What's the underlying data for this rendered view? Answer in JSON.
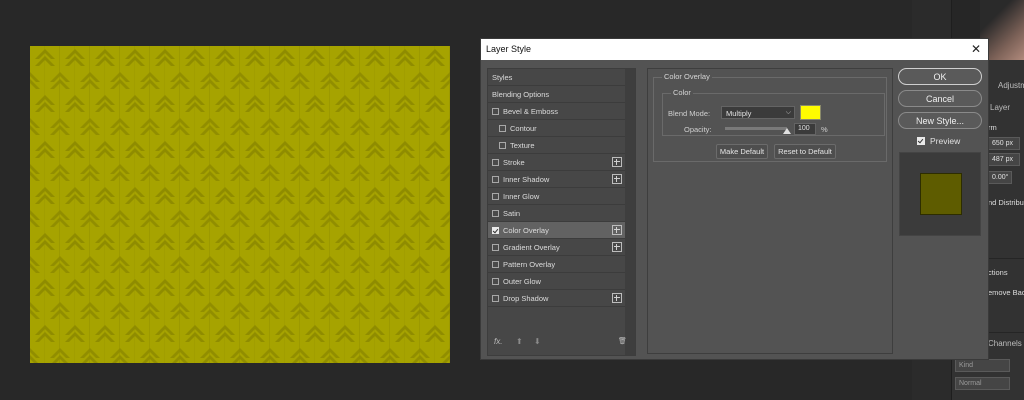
{
  "dialog": {
    "title": "Layer Style",
    "close": "✕"
  },
  "styles_list": [
    {
      "label": "Styles",
      "type": "header"
    },
    {
      "label": "Blending Options",
      "type": "header"
    },
    {
      "label": "Bevel & Emboss",
      "checked": false,
      "plus": false
    },
    {
      "label": "Contour",
      "checked": false,
      "sub": true
    },
    {
      "label": "Texture",
      "checked": false,
      "sub": true
    },
    {
      "label": "Stroke",
      "checked": false,
      "plus": true
    },
    {
      "label": "Inner Shadow",
      "checked": false,
      "plus": true
    },
    {
      "label": "Inner Glow",
      "checked": false
    },
    {
      "label": "Satin",
      "checked": false
    },
    {
      "label": "Color Overlay",
      "checked": true,
      "plus": true,
      "active": true
    },
    {
      "label": "Gradient Overlay",
      "checked": false,
      "plus": true
    },
    {
      "label": "Pattern Overlay",
      "checked": false
    },
    {
      "label": "Outer Glow",
      "checked": false
    },
    {
      "label": "Drop Shadow",
      "checked": false,
      "plus": true
    }
  ],
  "styles_footer": {
    "fx": "fx.",
    "up": "⬆",
    "down": "⬇",
    "trash": "🗑"
  },
  "color_overlay": {
    "group_title": "Color Overlay",
    "inner_title": "Color",
    "blend_mode_label": "Blend Mode:",
    "blend_mode_value": "Multiply",
    "color": "#fffc00",
    "opacity_label": "Opacity:",
    "opacity_value": "100",
    "opacity_unit": "%",
    "opacity_fraction": 1.0,
    "make_default": "Make Default",
    "reset_default": "Reset to Default"
  },
  "buttons": {
    "ok": "OK",
    "cancel": "Cancel",
    "new_style": "New Style...",
    "preview_label": "Preview",
    "preview_checked": true
  },
  "right_panel": {
    "tab_adjust": "Adjustm",
    "tab_layer": "Layer",
    "section_transform": "rm",
    "width": "650 px",
    "height": "487 px",
    "angle": "0.00°",
    "align_label": "nd Distribu",
    "quick_actions": "ctions",
    "remove_bg": "emove Back",
    "channels_tab": "Channels",
    "kind_placeholder": "Kind",
    "blend_normal": "Normal"
  },
  "colors": {
    "canvas": "#a6a300",
    "pattern_dark": "#8f8c00",
    "preview": "#5e5c00"
  }
}
